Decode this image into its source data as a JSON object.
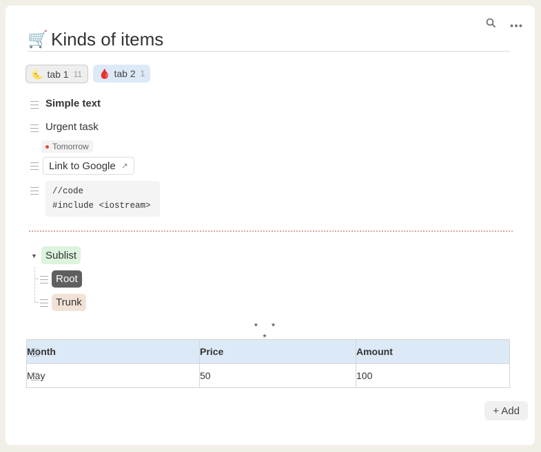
{
  "toolbar": {
    "search_icon": "search-icon",
    "more_icon": "more-horizontal-icon"
  },
  "page": {
    "icon": "🛒",
    "title": "Kinds of items"
  },
  "tabs": [
    {
      "icon": "🌜",
      "label": "tab 1",
      "count": "11",
      "active": true
    },
    {
      "icon": "🩸",
      "label": "tab 2",
      "count": "1",
      "active": false
    }
  ],
  "items": {
    "simple_text": "Simple text",
    "urgent_task": "Urgent task",
    "due_date": "Tomorrow",
    "link_label": "Link to Google",
    "link_arrow": "↗",
    "code_lines": [
      "//code",
      "#include <iostream>"
    ]
  },
  "sublist": {
    "label": "Sublist",
    "children": [
      "Root",
      "Trunk"
    ]
  },
  "separator": "* * *",
  "table": {
    "headers": [
      "Month",
      "Price",
      "Amount"
    ],
    "rows": [
      [
        "May",
        "50",
        "100"
      ]
    ]
  },
  "add_button": "+ Add",
  "colors": {
    "accent_blue": "#dce9f7",
    "sublist_green": "#ddf3dd",
    "root_dark": "#5f5f5f",
    "trunk_tan": "#f0e3d6",
    "due_red": "#e04a3a"
  }
}
